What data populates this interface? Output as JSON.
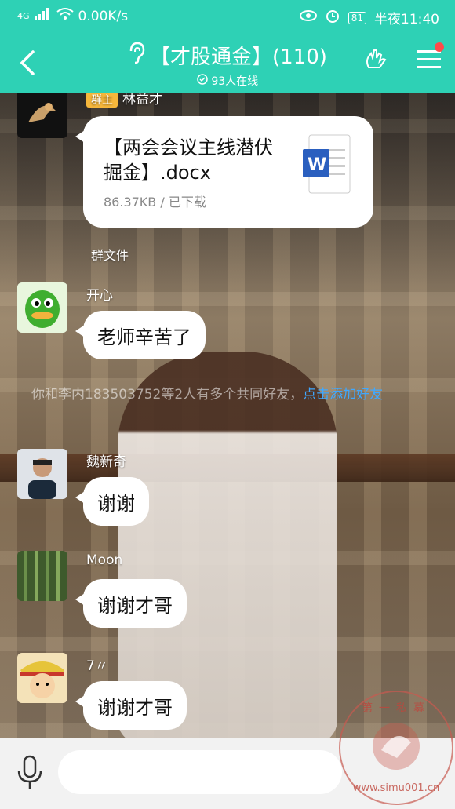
{
  "status": {
    "network": "4G",
    "speed": "0.00K/s",
    "battery": "81",
    "time": "半夜11:40"
  },
  "header": {
    "title": "【才股通金】(110)",
    "subtitle": "93人在线"
  },
  "messages": {
    "m1": {
      "role_tag": "群主",
      "sender": "林益才",
      "file_name": "【两会会议主线潜伏掘金】.docx",
      "file_meta": "86.37KB / 已下载",
      "label": "群文件"
    },
    "m2": {
      "sender": "开心",
      "text": "老师辛苦了"
    },
    "system": {
      "text": "你和李内183503752等2人有多个共同好友，",
      "link": "点击添加好友"
    },
    "m3": {
      "sender": "魏新奇",
      "text": "谢谢"
    },
    "m4": {
      "sender": "Moon",
      "text": "谢谢才哥"
    },
    "m5": {
      "sender": "7〃",
      "text": "谢谢才哥"
    }
  },
  "input": {
    "placeholder": ""
  },
  "watermark": {
    "top": "第一私募",
    "bottom": "www.simu001.cn"
  },
  "colors": {
    "accent": "#2ed1b5",
    "link": "#3fa8ff",
    "owner_tag": "#f6b73c"
  }
}
